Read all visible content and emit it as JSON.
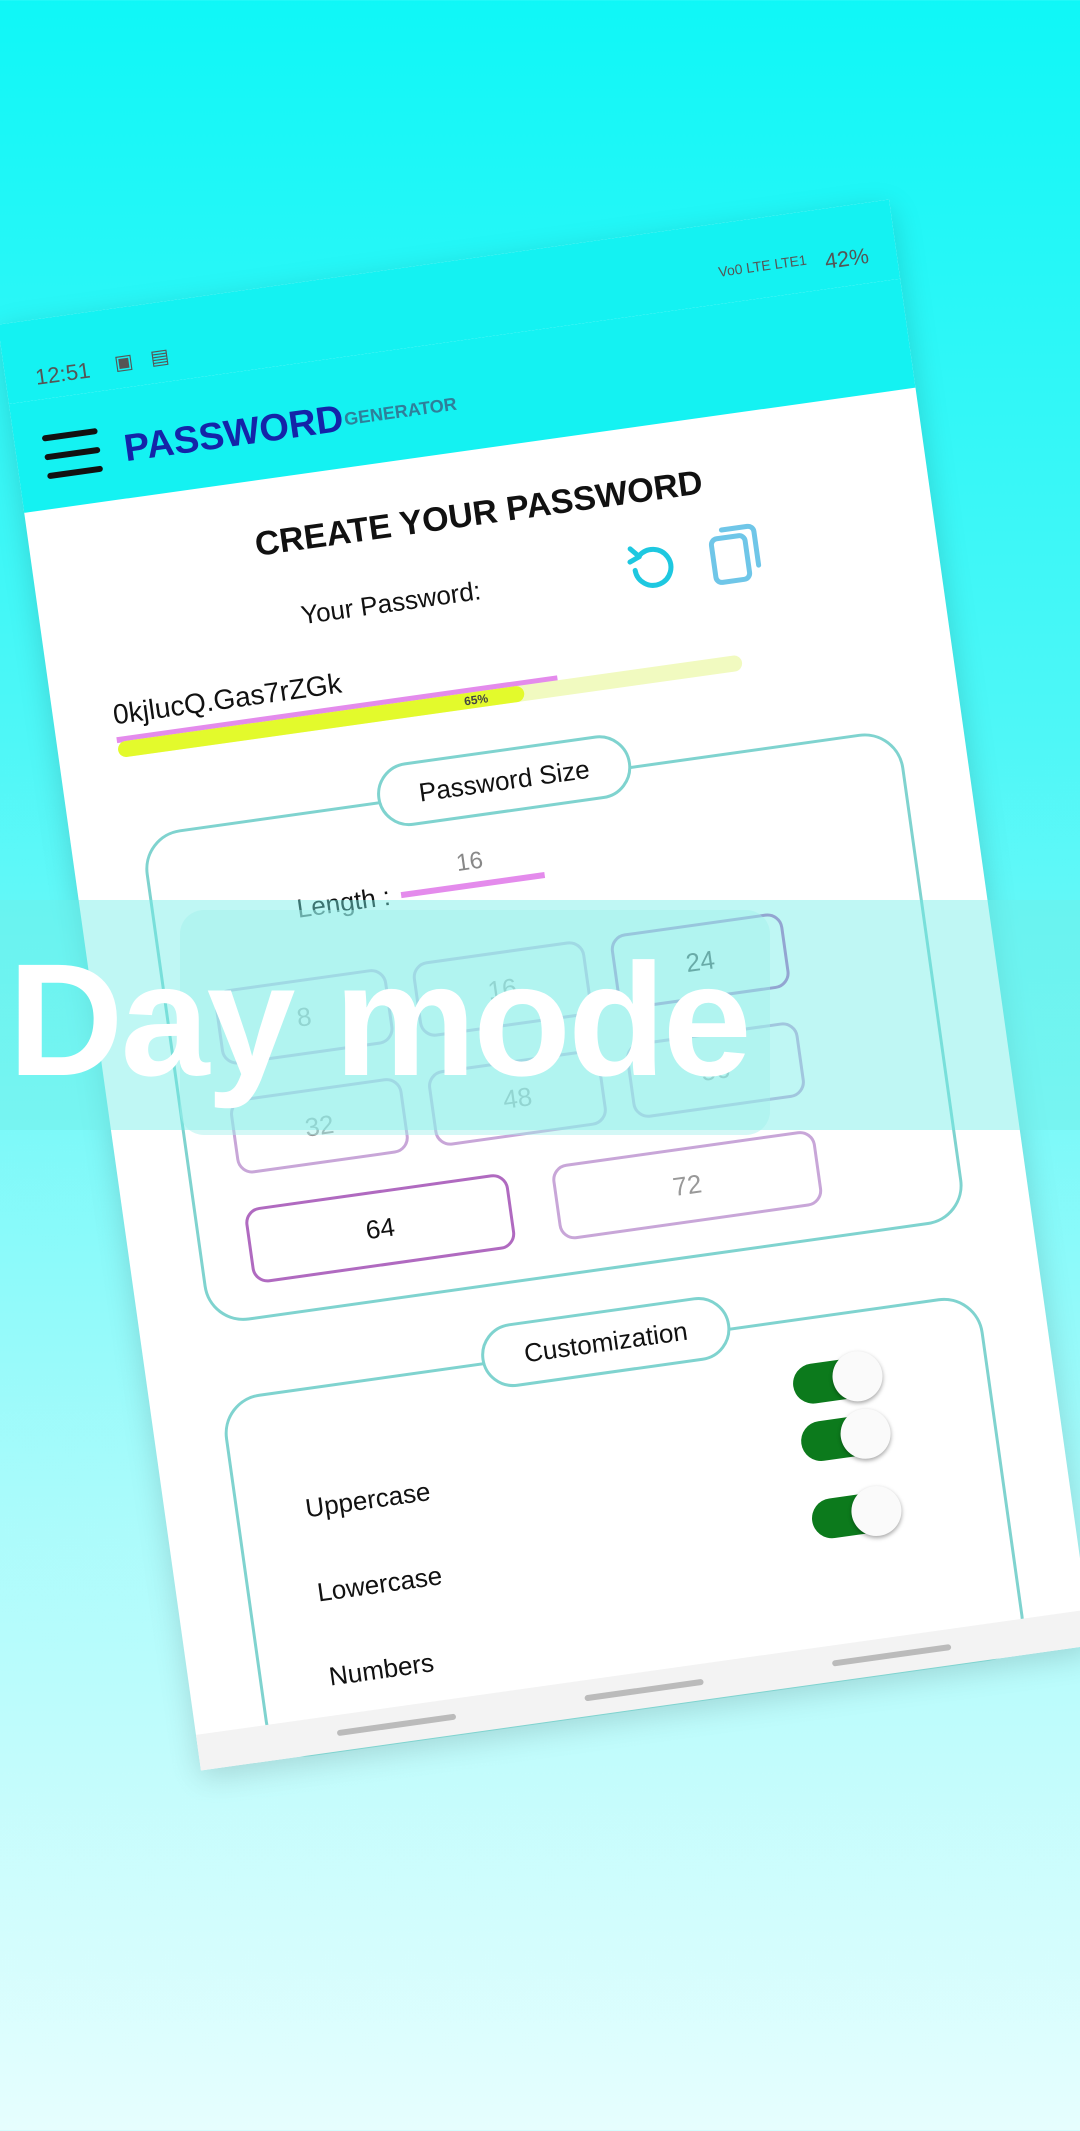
{
  "status_bar": {
    "time": "12:51",
    "network": "Vo0 LTE LTE1",
    "battery": "42%"
  },
  "app_bar": {
    "title": "PASSWORD",
    "subtitle": "GENERATOR"
  },
  "main": {
    "heading": "CREATE YOUR PASSWORD",
    "password_label": "Your Password:",
    "password_value": "0kjlucQ.Gas7rZGk",
    "strength": {
      "percent": 65,
      "label": "65%",
      "color": "#e3fa2c"
    }
  },
  "size_section": {
    "title": "Password Size",
    "length_label": "Length :",
    "length_value": "16",
    "options": [
      "8",
      "16",
      "24",
      "32",
      "48",
      "56",
      "64",
      "72"
    ]
  },
  "custom_section": {
    "title": "Customization",
    "options": [
      {
        "label": "Uppercase",
        "enabled": true
      },
      {
        "label": "Lowercase",
        "enabled": true
      },
      {
        "label": "Numbers",
        "enabled": true
      }
    ]
  },
  "overlay": {
    "text": "Day mode"
  },
  "colors": {
    "accent": "#14f2f2",
    "title": "#1424a8",
    "toggle": "#0c7a1c",
    "underline": "#e48bec"
  }
}
